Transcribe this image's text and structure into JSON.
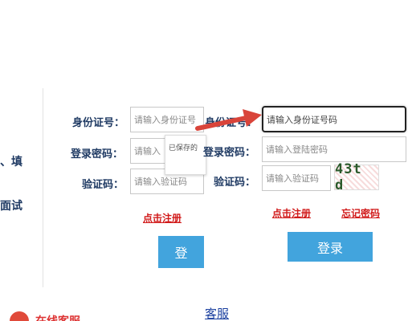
{
  "left_fragments": {
    "line1": "、填",
    "line2": "面试"
  },
  "back_form": {
    "id_label": "身份证号：",
    "id_placeholder": "请输入身份证号",
    "password_label": "登录密码：",
    "password_placeholder": "请输入",
    "captcha_label": "验证码：",
    "captcha_placeholder": "请输入验证码",
    "register_link": "点击注册",
    "login_button": "登"
  },
  "autocomplete_popup": {
    "text": "已保存的"
  },
  "front_form": {
    "id_label": "身份证号：",
    "id_placeholder": "请输入身份证号码",
    "password_label": "登录密码：",
    "password_placeholder": "请输入登陆密码",
    "captcha_label": "验证码：",
    "captcha_placeholder": "请输入验证码",
    "captcha_image_text": "43t d",
    "register_link": "点击注册",
    "forgot_link": "忘记密码",
    "login_button": "登录"
  },
  "footer": {
    "kefu_link": "客服",
    "online_text": "在线客服"
  },
  "colors": {
    "label": "#1f3a63",
    "link": "#d11a1a",
    "button": "#42a4dd",
    "arrow": "#d9443a"
  }
}
